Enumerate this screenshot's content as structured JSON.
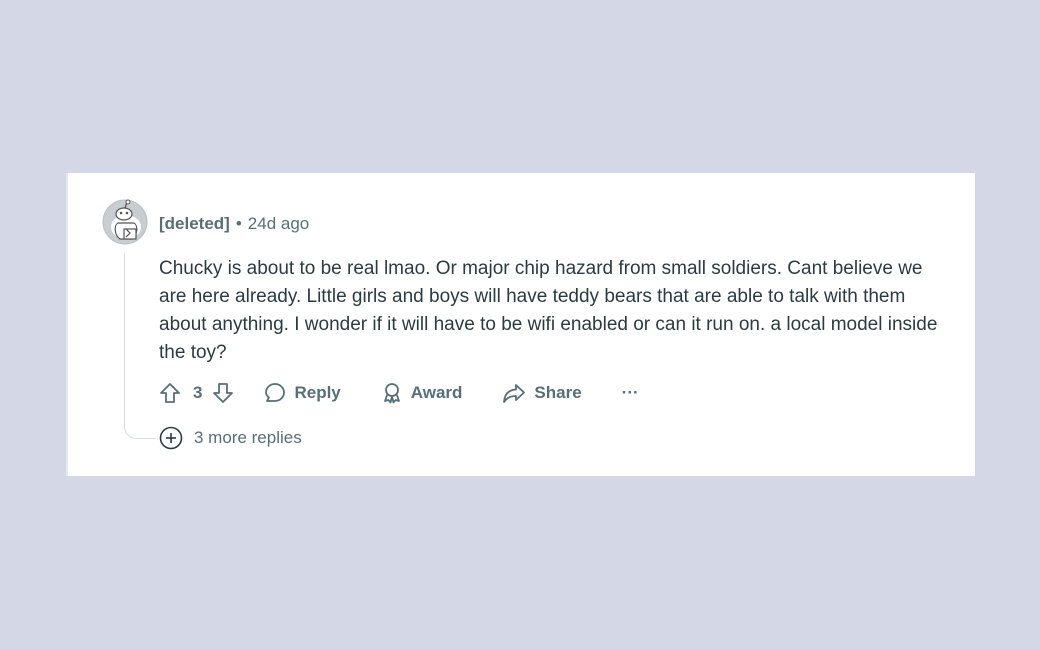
{
  "comment": {
    "author": "[deleted]",
    "separator": "•",
    "age": "24d ago",
    "body": "Chucky is about to be real lmao. Or major chip hazard from small soldiers. Cant believe we are here already. Little girls and boys will have teddy bears that are able to talk with them about anything. I wonder if it will have to be wifi enabled or can it run on. a local model inside the toy?",
    "votes": "3"
  },
  "actions": {
    "reply_label": "Reply",
    "award_label": "Award",
    "share_label": "Share",
    "more_label": "···"
  },
  "replies": {
    "more_label": "3 more replies"
  },
  "colors": {
    "background": "#d4d7e6",
    "card": "#ffffff",
    "meta_text": "#576f76",
    "body_text": "#2a3c42"
  },
  "icons": [
    "snoo-avatar-icon",
    "upvote-icon",
    "downvote-icon",
    "comment-bubble-icon",
    "award-icon",
    "share-arrow-icon",
    "plus-circle-icon"
  ]
}
